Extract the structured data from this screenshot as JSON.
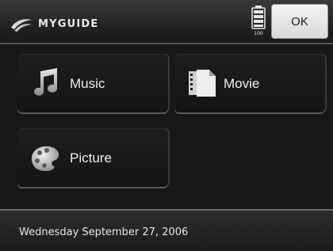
{
  "header": {
    "logo_text": "MYGUIDE",
    "logo_icon": "myguide-logo-icon",
    "battery_icon": "battery-icon",
    "battery_label": "100",
    "ok_label": "OK"
  },
  "menu": {
    "items": [
      {
        "label": "Music",
        "icon": "music-note-icon"
      },
      {
        "label": "Movie",
        "icon": "film-document-icon"
      },
      {
        "label": "Picture",
        "icon": "paint-palette-icon"
      }
    ]
  },
  "footer": {
    "date": "Wednesday September 27, 2006"
  },
  "colors": {
    "background": "#171717",
    "tile": "#1a1a1a",
    "button": "#e6e6e6"
  }
}
